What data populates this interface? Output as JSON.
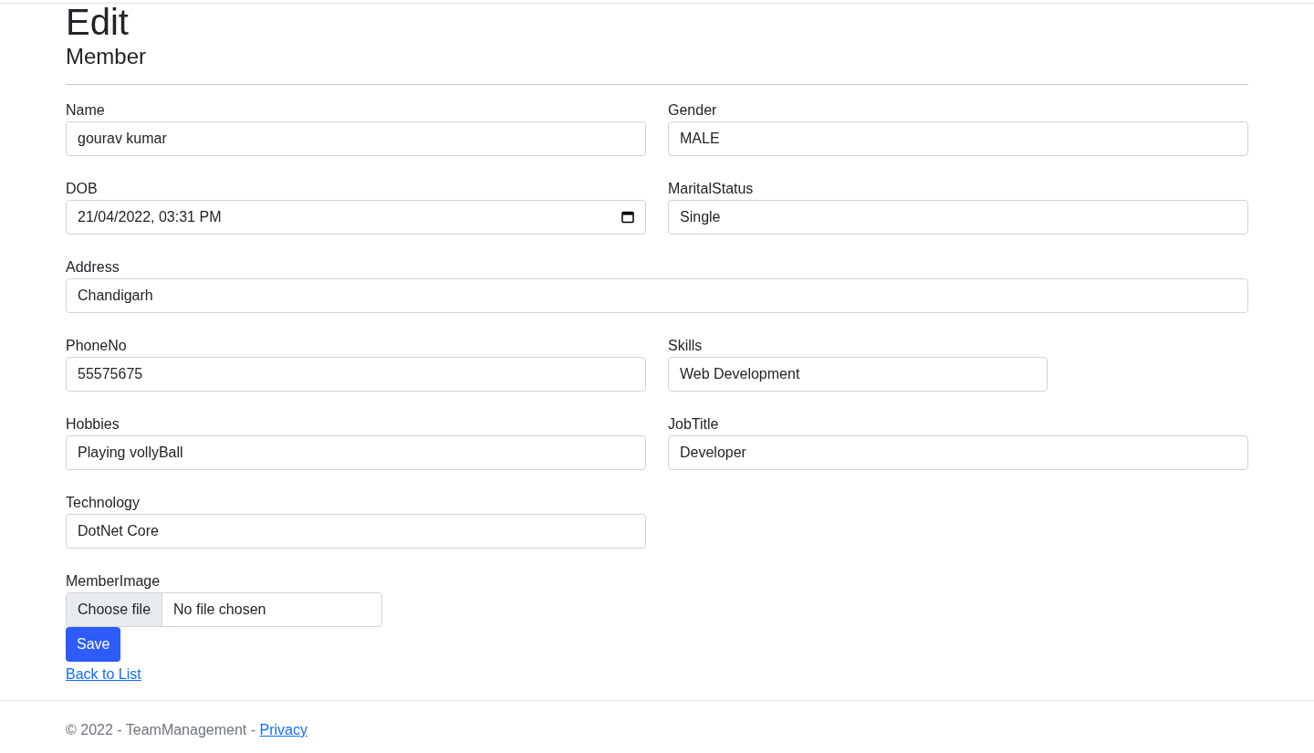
{
  "page": {
    "title": "Edit",
    "subtitle": "Member"
  },
  "rows": [
    [
      {
        "label": "Name",
        "kind": "text",
        "value": "gourav kumar"
      },
      {
        "label": "Gender",
        "kind": "text",
        "value": "MALE"
      }
    ],
    [
      {
        "label": "DOB",
        "kind": "date",
        "value": "21/04/2022, 03:31 PM"
      },
      {
        "label": "MaritalStatus",
        "kind": "text",
        "value": "Single"
      }
    ],
    [
      {
        "label": "Address",
        "kind": "text",
        "value": "Chandigarh"
      }
    ],
    [
      {
        "label": "PhoneNo",
        "kind": "text",
        "value": "55575675"
      },
      {
        "label": "Skills",
        "kind": "text",
        "value": "Web Development"
      }
    ],
    [
      {
        "label": "Hobbies",
        "kind": "text",
        "value": "Playing vollyBall"
      },
      {
        "label": "JobTitle",
        "kind": "text",
        "value": "Developer"
      }
    ],
    [
      {
        "label": "Technology",
        "kind": "text",
        "value": "DotNet Core"
      }
    ],
    [
      {
        "label": "MemberImage",
        "kind": "file",
        "button": "Choose file",
        "value": "No file chosen"
      }
    ]
  ],
  "save_button": "Save",
  "back_link": "Back to List",
  "footer": {
    "text": "© 2022 - TeamManagement - ",
    "link": "Privacy"
  }
}
